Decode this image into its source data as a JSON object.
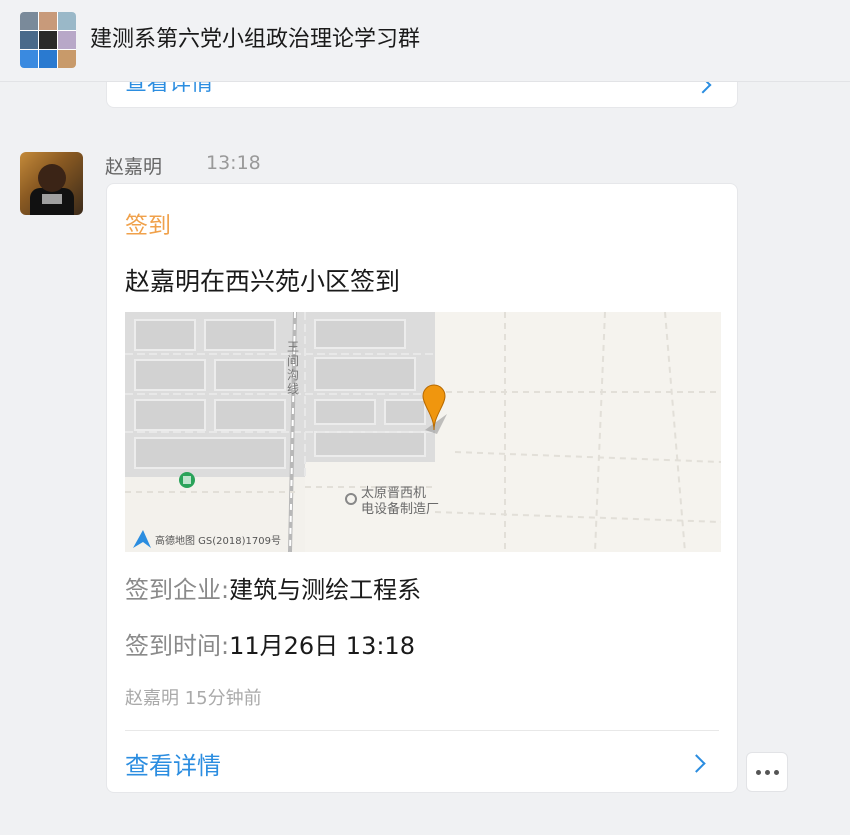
{
  "header": {
    "title": "建测系第六党小组政治理论学习群",
    "avatar_icon": "group-avatar-grid"
  },
  "previous_card": {
    "detail_link": "查看详情"
  },
  "message": {
    "sender": "赵嘉明",
    "time": "13:18",
    "card": {
      "tag": "签到",
      "title": "赵嘉明在西兴苑小区签到",
      "map": {
        "road_label": "王间沟线",
        "poi_label_line1": "太原晋西机",
        "poi_label_line2": "电设备制造厂",
        "attribution": "高德地图  GS(2018)1709号",
        "pin_color": "#f0960e"
      },
      "company_label": "签到企业:",
      "company_value": "建筑与测绘工程系",
      "time_label": "签到时间:",
      "time_value": "11月26日 13:18",
      "meta": "赵嘉明  15分钟前",
      "detail_link": "查看详情"
    }
  },
  "colors": {
    "accent_link": "#2b8de0",
    "tag_orange": "#f0a14b",
    "background": "#f0f1f3"
  }
}
